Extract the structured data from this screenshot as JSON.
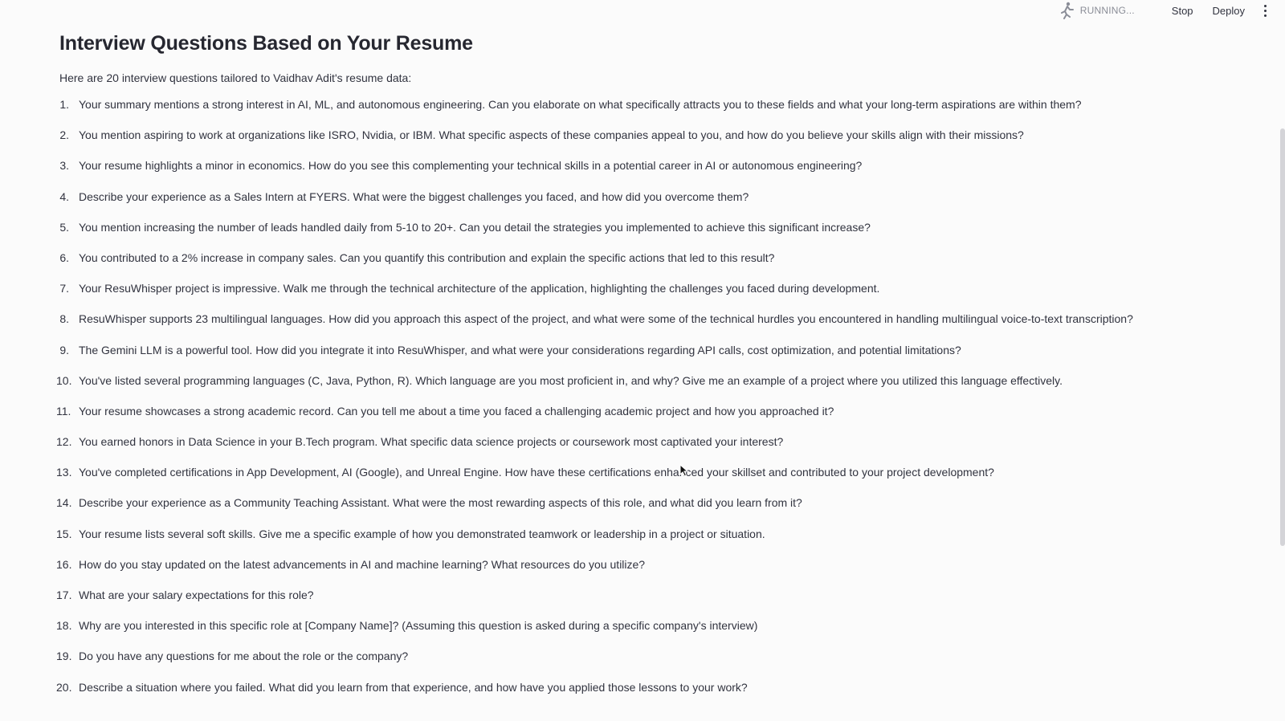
{
  "header": {
    "status_text": "RUNNING...",
    "stop_label": "Stop",
    "deploy_label": "Deploy",
    "status_icon": "running-person-icon",
    "menu_icon": "kebab-menu-icon"
  },
  "main": {
    "title": "Interview Questions Based on Your Resume",
    "intro": "Here are 20 interview questions tailored to Vaidhav Adit's resume data:",
    "questions": [
      {
        "num": "1.",
        "text": "Your summary mentions a strong interest in AI, ML, and autonomous engineering. Can you elaborate on what specifically attracts you to these fields and what your long-term aspirations are within them?"
      },
      {
        "num": "2.",
        "text": "You mention aspiring to work at organizations like ISRO, Nvidia, or IBM. What specific aspects of these companies appeal to you, and how do you believe your skills align with their missions?"
      },
      {
        "num": "3.",
        "text": "Your resume highlights a minor in economics. How do you see this complementing your technical skills in a potential career in AI or autonomous engineering?"
      },
      {
        "num": "4.",
        "text": "Describe your experience as a Sales Intern at FYERS. What were the biggest challenges you faced, and how did you overcome them?"
      },
      {
        "num": "5.",
        "text": "You mention increasing the number of leads handled daily from 5-10 to 20+. Can you detail the strategies you implemented to achieve this significant increase?"
      },
      {
        "num": "6.",
        "text": "You contributed to a 2% increase in company sales. Can you quantify this contribution and explain the specific actions that led to this result?"
      },
      {
        "num": "7.",
        "text": "Your ResuWhisper project is impressive. Walk me through the technical architecture of the application, highlighting the challenges you faced during development."
      },
      {
        "num": "8.",
        "text": "ResuWhisper supports 23 multilingual languages. How did you approach this aspect of the project, and what were some of the technical hurdles you encountered in handling multilingual voice-to-text transcription?"
      },
      {
        "num": "9.",
        "text": "The Gemini LLM is a powerful tool. How did you integrate it into ResuWhisper, and what were your considerations regarding API calls, cost optimization, and potential limitations?"
      },
      {
        "num": "10.",
        "text": "You've listed several programming languages (C, Java, Python, R). Which language are you most proficient in, and why? Give me an example of a project where you utilized this language effectively."
      },
      {
        "num": "11.",
        "text": "Your resume showcases a strong academic record. Can you tell me about a time you faced a challenging academic project and how you approached it?"
      },
      {
        "num": "12.",
        "text": "You earned honors in Data Science in your B.Tech program. What specific data science projects or coursework most captivated your interest?"
      },
      {
        "num": "13.",
        "text": "You've completed certifications in App Development, AI (Google), and Unreal Engine. How have these certifications enhanced your skillset and contributed to your project development?"
      },
      {
        "num": "14.",
        "text": "Describe your experience as a Community Teaching Assistant. What were the most rewarding aspects of this role, and what did you learn from it?"
      },
      {
        "num": "15.",
        "text": "Your resume lists several soft skills. Give me a specific example of how you demonstrated teamwork or leadership in a project or situation."
      },
      {
        "num": "16.",
        "text": "How do you stay updated on the latest advancements in AI and machine learning? What resources do you utilize?"
      },
      {
        "num": "17.",
        "text": "What are your salary expectations for this role?"
      },
      {
        "num": "18.",
        "text": "Why are you interested in this specific role at [Company Name]? (Assuming this question is asked during a specific company's interview)"
      },
      {
        "num": "19.",
        "text": "Do you have any questions for me about the role or the company?"
      },
      {
        "num": "20.",
        "text": "Describe a situation where you failed. What did you learn from that experience, and how have you applied those lessons to your work?"
      }
    ]
  },
  "colors": {
    "background": "#fbfbfb",
    "text": "#31333f",
    "status_text": "#8a8d97"
  }
}
